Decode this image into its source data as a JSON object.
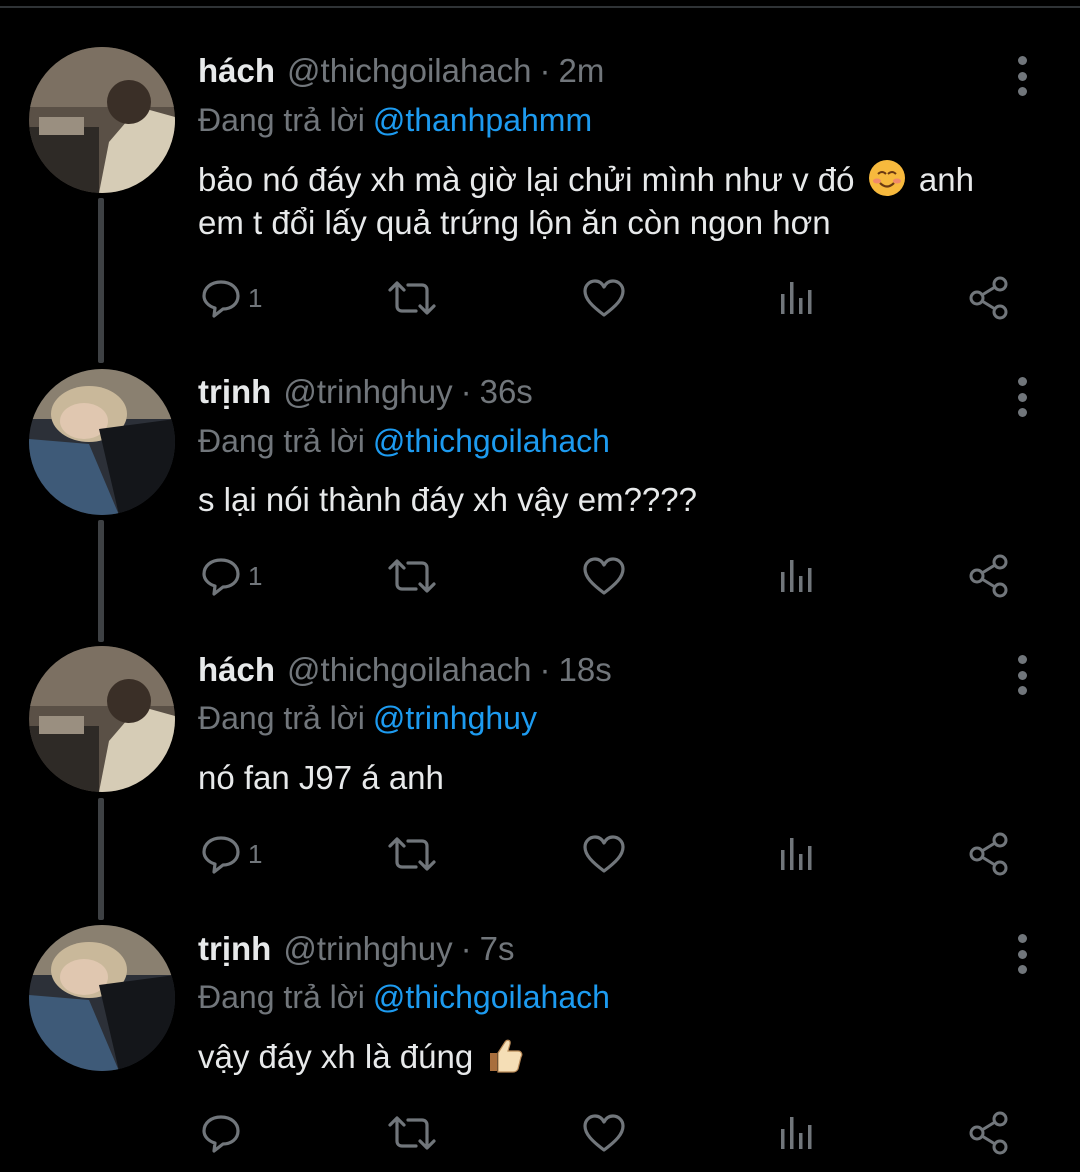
{
  "replying_prefix": "Đang trả lời",
  "colors": {
    "background": "#000000",
    "text": "#e7e9ea",
    "muted": "#71767b",
    "link": "#1d9bf0",
    "thread_line": "#3e4144"
  },
  "icons": {
    "reply": "reply-icon",
    "retweet": "retweet-icon",
    "like": "heart-icon",
    "views": "analytics-icon",
    "share": "share-icon",
    "more": "more-vertical-icon"
  },
  "tweets": [
    {
      "name": "hách",
      "handle": "@thichgoilahach",
      "separator": "·",
      "time": "2m",
      "replying_to": "@thanhpahmm",
      "text_line1": "bảo nó đáy xh mà giờ lại chửi mình như v đó",
      "text_line1_after": "anh",
      "text_line2": "em t đổi lấy quả trứng lộn ăn còn ngon hơn",
      "emoji": "smiling-face-emoji",
      "reply_count": "1"
    },
    {
      "name": "trịnh",
      "handle": "@trinhghuy",
      "separator": "·",
      "time": "36s",
      "replying_to": "@thichgoilahach",
      "text": "s lại nói thành đáy xh vậy em????",
      "reply_count": "1"
    },
    {
      "name": "hách",
      "handle": "@thichgoilahach",
      "separator": "·",
      "time": "18s",
      "replying_to": "@trinhghuy",
      "text": "nó fan J97 á anh",
      "reply_count": "1"
    },
    {
      "name": "trịnh",
      "handle": "@trinhghuy",
      "separator": "·",
      "time": "7s",
      "replying_to": "@thichgoilahach",
      "text": "vậy đáy xh là đúng",
      "emoji": "thumbs-up-emoji",
      "reply_count": ""
    }
  ]
}
